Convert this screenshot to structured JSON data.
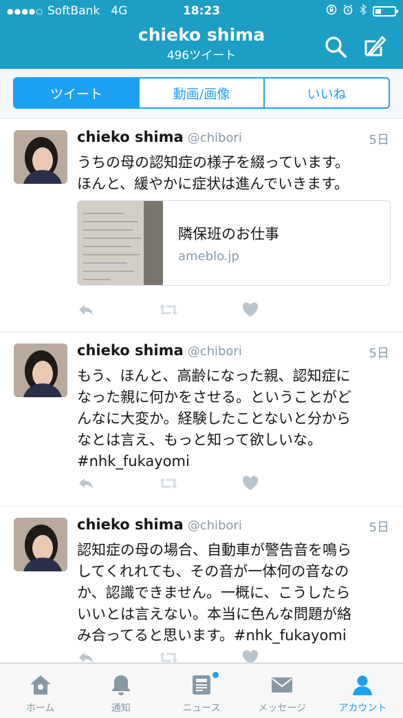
{
  "status_bar": {
    "signal_dots": "●●●●○",
    "carrier": "SoftBank",
    "network": "4G",
    "time": "18:23"
  },
  "header": {
    "name": "chieko shima",
    "tweet_count": "496ツイート",
    "search_icon": "search-icon",
    "compose_icon": "compose-icon"
  },
  "segments": [
    {
      "label": "ツイート",
      "active": true
    },
    {
      "label": "動画/画像",
      "active": false
    },
    {
      "label": "いいね",
      "active": false
    }
  ],
  "tweets": [
    {
      "name": "chieko shima",
      "handle": "@chibori",
      "time": "5日",
      "text": "うちの母の認知症の様子を綴っています。\nほんと、緩やかに症状は進んでいきます。",
      "card": {
        "title": "隣保班のお仕事",
        "domain": "ameblo.jp"
      }
    },
    {
      "name": "chieko shima",
      "handle": "@chibori",
      "time": "5日",
      "text": "もう、ほんと、高齢になった親、認知症に\nなった親に何かをさせる。ということがど\nんなに大変か。経験したことないと分から\nなとは言え、もっと知って欲しいな。\n#nhk_fukayomi"
    },
    {
      "name": "chieko shima",
      "handle": "@chibori",
      "time": "5日",
      "text": "認知症の母の場合、自動車が警告音を鳴ら\nしてくれれても、その音が一体何の音なの\nか、認識できません。一概に、こうしたら\nいいとは言えない。本当に色んな問題が絡\nみ合ってると思います。#nhk_fukayomi"
    }
  ],
  "tabbar": [
    {
      "label": "ホーム",
      "icon": "home-icon"
    },
    {
      "label": "通知",
      "icon": "bell-icon"
    },
    {
      "label": "ニュース",
      "icon": "news-icon"
    },
    {
      "label": "メッセージ",
      "icon": "mail-icon"
    },
    {
      "label": "アカウント",
      "icon": "person-icon",
      "active": true
    }
  ],
  "colors": {
    "header_bg": "#1d9ec4",
    "accent": "#1da1f2",
    "muted": "#8899a6"
  }
}
